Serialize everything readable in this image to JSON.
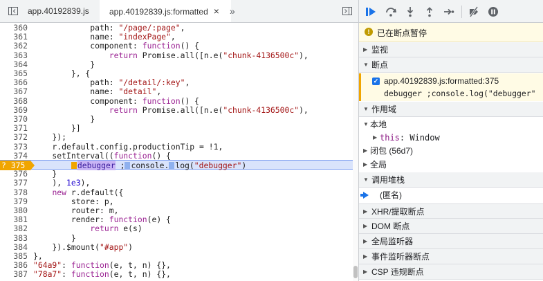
{
  "tabs": [
    {
      "label": "app.40192839.js",
      "active": false
    },
    {
      "label": "app.40192839.js:formatted",
      "active": true,
      "close": "×"
    }
  ],
  "tabs_overflow": "»",
  "code_lines": [
    {
      "n": "360",
      "code": "            path: \"/page/:page\","
    },
    {
      "n": "361",
      "code": "            name: \"indexPage\","
    },
    {
      "n": "362",
      "code": "            component: function() {"
    },
    {
      "n": "363",
      "code": "                return Promise.all([n.e(\"chunk-4136500c\"),"
    },
    {
      "n": "364",
      "code": "            }"
    },
    {
      "n": "365",
      "code": "        }, {"
    },
    {
      "n": "366",
      "code": "            path: \"/detail/:key\","
    },
    {
      "n": "367",
      "code": "            name: \"detail\","
    },
    {
      "n": "368",
      "code": "            component: function() {"
    },
    {
      "n": "369",
      "code": "                return Promise.all([n.e(\"chunk-4136500c\"),"
    },
    {
      "n": "370",
      "code": "            }"
    },
    {
      "n": "371",
      "code": "        }]"
    },
    {
      "n": "372",
      "code": "    });"
    },
    {
      "n": "373",
      "code": "    r.default.config.productionTip = !1,"
    },
    {
      "n": "374",
      "code": "    setInterval((function() {"
    },
    {
      "n": "375",
      "code": "",
      "paused": true
    },
    {
      "n": "376",
      "code": "    }"
    },
    {
      "n": "377",
      "code": "    ), 1e3),"
    },
    {
      "n": "378",
      "code": "    new r.default({"
    },
    {
      "n": "379",
      "code": "        store: p,"
    },
    {
      "n": "380",
      "code": "        router: m,"
    },
    {
      "n": "381",
      "code": "        render: function(e) {"
    },
    {
      "n": "382",
      "code": "            return e(s)"
    },
    {
      "n": "383",
      "code": "        }"
    },
    {
      "n": "384",
      "code": "    }).$mount(\"#app\")"
    },
    {
      "n": "385",
      "code": "},"
    },
    {
      "n": "386",
      "code": "\"64a9\": function(e, t, n) {},"
    },
    {
      "n": "387",
      "code": "\"78a7\": function(e, t, n) {},"
    }
  ],
  "paused_line": {
    "marker": "? 375",
    "indent": "        ",
    "kw": "debugger",
    "mid": " ;",
    "obj": "console.",
    "call": "log(",
    "str": "\"debugger\"",
    "end": ")"
  },
  "debugger": {
    "paused_text": "已在断点暂停",
    "paused_icon": "!",
    "sections": {
      "watch": "监视",
      "breakpoints": "断点",
      "scope": "作用域",
      "callstack": "调用堆栈",
      "xhr": "XHR/提取断点",
      "dom": "DOM 断点",
      "global_listeners": "全局监听器",
      "event_listeners": "事件监听器断点",
      "csp": "CSP 违规断点"
    },
    "breakpoint": {
      "location": "app.40192839.js:formatted:375",
      "code": "debugger ;console.log(\"debugger\""
    },
    "scope": {
      "local": "本地",
      "this_name": "this",
      "this_value": ": Window",
      "closure": "闭包 (56d7)",
      "global": "全局"
    },
    "callstack_item": "(匿名)"
  },
  "colors": {
    "accent": "#1a73e8",
    "breakpoint": "#f0a500",
    "paused_banner": "#fffbe5"
  }
}
